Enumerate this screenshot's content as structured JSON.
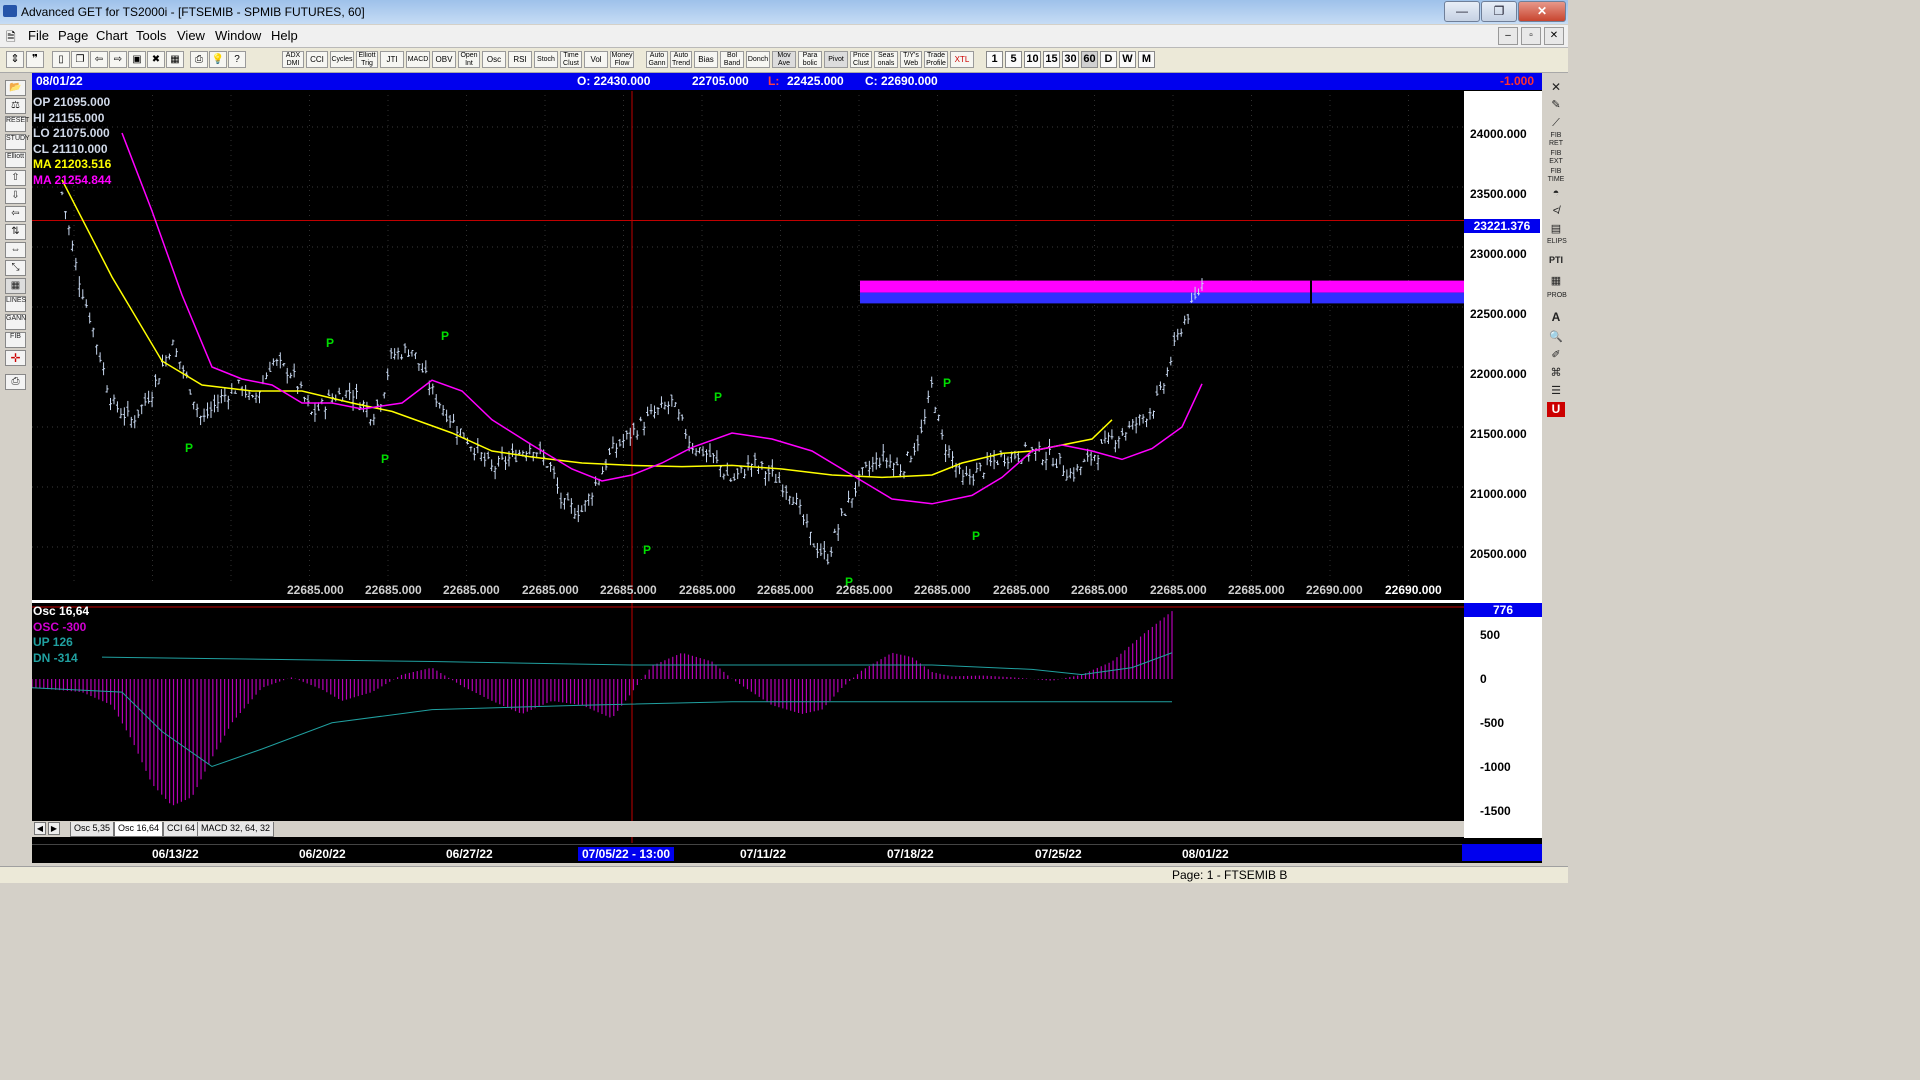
{
  "window": {
    "title": "Advanced GET for TS2000i - [FTSEMIB - SPMIB FUTURES, 60]",
    "buttons": [
      "—",
      "❐",
      "✕"
    ]
  },
  "menu": {
    "items": [
      "File",
      "Page",
      "Chart",
      "Tools",
      "View",
      "Window",
      "Help"
    ],
    "mdi_buttons": [
      "–",
      "▫",
      "✕"
    ]
  },
  "toolbar": {
    "studies": [
      "ADX DMI",
      "CCI",
      "Cycles",
      "Elliott Trig",
      "JTI",
      "MACD",
      "OBV",
      "Open Int",
      "Osc",
      "RSI",
      "Stoch",
      "Time Clust",
      "Vol",
      "Money Flow",
      "Auto Gann",
      "Auto Trend",
      "Bias",
      "Bol Band",
      "Donch",
      "Mov Ave",
      "Para bolic",
      "Pivot",
      "Price Clust",
      "Seas onals",
      "T/Y's Web",
      "Trade Profile",
      "XTL"
    ],
    "intervals": [
      "1",
      "5",
      "10",
      "15",
      "30",
      "60",
      "D",
      "W",
      "M"
    ],
    "active_interval": "60"
  },
  "left_tools": [
    "RESET",
    "STUDY",
    "Elliott",
    "LINES",
    "GANN",
    "FIB"
  ],
  "right_tools": [
    "FIB RET",
    "FIB EXT",
    "FIB TIME",
    "ELIPS",
    "PTI",
    "PROB",
    "A",
    "U"
  ],
  "price_header": {
    "date": "08/01/22",
    "open": "O:  22430.000",
    "high": "22705.000",
    "low_label": "L:",
    "low": "22425.000",
    "close": "C:  22690.000",
    "change": "-1.000"
  },
  "info": {
    "op": "OP  21095.000",
    "hi": "HI   21155.000",
    "lo": "LO  21075.000",
    "cl": "CL  21110.000",
    "ma1": "MA  21203.516",
    "ma2": "MA  21254.844"
  },
  "price_axis": {
    "labels": [
      "24000.000",
      "23500.000",
      "23000.000",
      "22500.000",
      "22000.000",
      "21500.000",
      "21000.000",
      "20500.000"
    ],
    "cursor_price": "23221.376",
    "cursor_color": "#0000ee"
  },
  "pivot_label": "P",
  "volume_labels": [
    "22685.000",
    "22685.000",
    "22685.000",
    "22685.000",
    "22685.000",
    "22685.000",
    "22685.000",
    "22685.000",
    "22685.000",
    "22685.000",
    "22685.000",
    "22685.000",
    "22685.000",
    "22690.000",
    "22690.000"
  ],
  "oscillator": {
    "header": "Osc 16,64",
    "osc": "OSC -300",
    "up": "UP   126",
    "dn": "DN   -314",
    "badge": "776",
    "axis_labels": [
      "500",
      "0",
      "-500",
      "-1000",
      "-1500"
    ]
  },
  "study_tabs": [
    "Osc 5,35",
    "Osc 16,64",
    "CCI 64",
    "MACD 32, 64, 32"
  ],
  "study_tab_active": 1,
  "tab_nav": [
    "◀",
    "▶"
  ],
  "dates": [
    "06/13/22",
    "06/20/22",
    "06/27/22",
    "07/05/22 - 13:00",
    "07/11/22",
    "07/18/22",
    "07/25/22",
    "08/01/22"
  ],
  "status": {
    "page": "Page: 1 - FTSEMIB B"
  },
  "colors": {
    "background": "#000000",
    "header_blue": "#0000ee",
    "ma_fast": "#ffff00",
    "ma_slow": "#ff00ff",
    "bars": "#c8d8f0",
    "pivot": "#00dd00",
    "osc_hist": "#b400b4",
    "osc_lines": "#20a0a0",
    "projection_magenta": "#ff00ff",
    "projection_blue": "#3030ff",
    "cursor_red": "#c00000"
  },
  "chart_data": {
    "type": "candlestick",
    "symbol": "FTSEMIB - SPMIB FUTURES",
    "interval": "60",
    "x_dates": [
      "06/13/22",
      "06/20/22",
      "06/27/22",
      "07/05/22",
      "07/11/22",
      "07/18/22",
      "07/25/22",
      "08/01/22"
    ],
    "ylim": [
      20300,
      24300
    ],
    "close_path": [
      [
        0.03,
        23450
      ],
      [
        0.045,
        22800
      ],
      [
        0.06,
        22350
      ],
      [
        0.08,
        21700
      ],
      [
        0.1,
        21550
      ],
      [
        0.12,
        21800
      ],
      [
        0.14,
        22200
      ],
      [
        0.155,
        21900
      ],
      [
        0.17,
        21550
      ],
      [
        0.19,
        21750
      ],
      [
        0.21,
        21850
      ],
      [
        0.22,
        21700
      ],
      [
        0.23,
        21850
      ],
      [
        0.24,
        22050
      ],
      [
        0.26,
        21950
      ],
      [
        0.28,
        21600
      ],
      [
        0.3,
        21750
      ],
      [
        0.32,
        21800
      ],
      [
        0.34,
        21600
      ],
      [
        0.35,
        21750
      ],
      [
        0.36,
        22100
      ],
      [
        0.38,
        22150
      ],
      [
        0.4,
        21800
      ],
      [
        0.42,
        21550
      ],
      [
        0.44,
        21350
      ],
      [
        0.46,
        21150
      ],
      [
        0.48,
        21250
      ],
      [
        0.5,
        21350
      ],
      [
        0.52,
        21150
      ],
      [
        0.53,
        20850
      ],
      [
        0.55,
        20800
      ],
      [
        0.565,
        21050
      ],
      [
        0.58,
        21300
      ],
      [
        0.6,
        21450
      ],
      [
        0.62,
        21600
      ],
      [
        0.64,
        21700
      ],
      [
        0.66,
        21350
      ],
      [
        0.68,
        21250
      ],
      [
        0.7,
        21050
      ],
      [
        0.72,
        21200
      ],
      [
        0.74,
        21100
      ],
      [
        0.76,
        20950
      ],
      [
        0.78,
        20550
      ],
      [
        0.795,
        20400
      ],
      [
        0.81,
        20750
      ],
      [
        0.83,
        21100
      ],
      [
        0.85,
        21250
      ],
      [
        0.87,
        21150
      ],
      [
        0.89,
        21450
      ],
      [
        0.9,
        21850
      ],
      [
        0.91,
        21400
      ],
      [
        0.92,
        21250
      ],
      [
        0.93,
        21050
      ],
      [
        0.95,
        21150
      ],
      [
        0.97,
        21250
      ],
      [
        1.0,
        21300
      ],
      [
        1.02,
        21250
      ],
      [
        1.04,
        21100
      ],
      [
        1.06,
        21250
      ],
      [
        1.08,
        21400
      ],
      [
        1.1,
        21500
      ],
      [
        1.12,
        21650
      ],
      [
        1.13,
        21800
      ],
      [
        1.14,
        22100
      ],
      [
        1.15,
        22350
      ],
      [
        1.16,
        22500
      ],
      [
        1.17,
        22690
      ]
    ],
    "ma_yellow": [
      [
        0.03,
        23560
      ],
      [
        0.08,
        22750
      ],
      [
        0.13,
        22050
      ],
      [
        0.17,
        21850
      ],
      [
        0.22,
        21800
      ],
      [
        0.27,
        21800
      ],
      [
        0.32,
        21700
      ],
      [
        0.36,
        21630
      ],
      [
        0.42,
        21450
      ],
      [
        0.46,
        21300
      ],
      [
        0.5,
        21250
      ],
      [
        0.55,
        21200
      ],
      [
        0.6,
        21180
      ],
      [
        0.65,
        21170
      ],
      [
        0.7,
        21180
      ],
      [
        0.75,
        21150
      ],
      [
        0.8,
        21100
      ],
      [
        0.85,
        21080
      ],
      [
        0.9,
        21100
      ],
      [
        0.93,
        21200
      ],
      [
        0.97,
        21280
      ],
      [
        1.0,
        21300
      ],
      [
        1.03,
        21350
      ],
      [
        1.06,
        21400
      ],
      [
        1.08,
        21560
      ]
    ],
    "ma_magenta": [
      [
        0.09,
        23950
      ],
      [
        0.12,
        23300
      ],
      [
        0.15,
        22600
      ],
      [
        0.18,
        22000
      ],
      [
        0.21,
        21900
      ],
      [
        0.24,
        21850
      ],
      [
        0.27,
        21700
      ],
      [
        0.3,
        21700
      ],
      [
        0.33,
        21650
      ],
      [
        0.37,
        21700
      ],
      [
        0.4,
        21890
      ],
      [
        0.43,
        21800
      ],
      [
        0.46,
        21560
      ],
      [
        0.5,
        21350
      ],
      [
        0.54,
        21150
      ],
      [
        0.57,
        21050
      ],
      [
        0.6,
        21100
      ],
      [
        0.63,
        21200
      ],
      [
        0.66,
        21330
      ],
      [
        0.7,
        21450
      ],
      [
        0.74,
        21400
      ],
      [
        0.78,
        21300
      ],
      [
        0.82,
        21100
      ],
      [
        0.86,
        20900
      ],
      [
        0.9,
        20860
      ],
      [
        0.94,
        20930
      ],
      [
        0.97,
        21080
      ],
      [
        1.0,
        21300
      ],
      [
        1.03,
        21350
      ],
      [
        1.06,
        21300
      ],
      [
        1.09,
        21230
      ],
      [
        1.12,
        21320
      ],
      [
        1.15,
        21500
      ],
      [
        1.17,
        21860
      ]
    ],
    "projection_zone": {
      "high": 22720,
      "mid": 22620,
      "low": 22530
    },
    "pivots": [
      {
        "type": "low",
        "price": 21450,
        "date_pos": 0.14
      },
      {
        "type": "high",
        "price": 22200,
        "date_pos": 0.235
      },
      {
        "type": "low",
        "price": 21330,
        "date_pos": 0.3
      },
      {
        "type": "high",
        "price": 22250,
        "date_pos": 0.33
      },
      {
        "type": "low",
        "price": 20630,
        "date_pos": 0.565
      },
      {
        "type": "high",
        "price": 21800,
        "date_pos": 0.6
      },
      {
        "type": "low",
        "price": 20360,
        "date_pos": 0.73
      },
      {
        "type": "high",
        "price": 21900,
        "date_pos": 0.8
      },
      {
        "type": "low",
        "price": 20650,
        "date_pos": 0.82
      }
    ],
    "oscillator": {
      "ylim": [
        -1700,
        900
      ],
      "values": [
        [
          0.0,
          -100
        ],
        [
          0.05,
          -150
        ],
        [
          0.08,
          -300
        ],
        [
          0.1,
          -700
        ],
        [
          0.12,
          -1200
        ],
        [
          0.14,
          -1450
        ],
        [
          0.16,
          -1350
        ],
        [
          0.18,
          -900
        ],
        [
          0.2,
          -500
        ],
        [
          0.23,
          -100
        ],
        [
          0.26,
          20
        ],
        [
          0.29,
          -120
        ],
        [
          0.31,
          -250
        ],
        [
          0.34,
          -150
        ],
        [
          0.37,
          50
        ],
        [
          0.4,
          130
        ],
        [
          0.43,
          -80
        ],
        [
          0.46,
          -250
        ],
        [
          0.49,
          -400
        ],
        [
          0.52,
          -250
        ],
        [
          0.55,
          -300
        ],
        [
          0.58,
          -450
        ],
        [
          0.6,
          -150
        ],
        [
          0.62,
          150
        ],
        [
          0.65,
          300
        ],
        [
          0.68,
          200
        ],
        [
          0.7,
          0
        ],
        [
          0.72,
          -150
        ],
        [
          0.74,
          -300
        ],
        [
          0.77,
          -400
        ],
        [
          0.79,
          -350
        ],
        [
          0.81,
          -100
        ],
        [
          0.83,
          100
        ],
        [
          0.86,
          300
        ],
        [
          0.88,
          250
        ],
        [
          0.9,
          80
        ],
        [
          0.92,
          30
        ],
        [
          0.95,
          40
        ],
        [
          0.98,
          20
        ],
        [
          1.0,
          0
        ],
        [
          1.02,
          -20
        ],
        [
          1.05,
          50
        ],
        [
          1.08,
          200
        ],
        [
          1.11,
          500
        ],
        [
          1.14,
          776
        ]
      ],
      "up_line": [
        [
          0.07,
          250
        ],
        [
          0.4,
          200
        ],
        [
          0.6,
          160
        ],
        [
          0.78,
          160
        ],
        [
          0.9,
          160
        ],
        [
          1.0,
          110
        ],
        [
          1.05,
          50
        ],
        [
          1.1,
          130
        ],
        [
          1.14,
          300
        ]
      ],
      "dn_line": [
        [
          0.0,
          -100
        ],
        [
          0.09,
          -150
        ],
        [
          0.13,
          -600
        ],
        [
          0.18,
          -1000
        ],
        [
          0.23,
          -800
        ],
        [
          0.3,
          -500
        ],
        [
          0.4,
          -350
        ],
        [
          0.55,
          -300
        ],
        [
          0.7,
          -260
        ],
        [
          0.85,
          -260
        ],
        [
          1.0,
          -260
        ],
        [
          1.14,
          -260
        ]
      ]
    }
  }
}
